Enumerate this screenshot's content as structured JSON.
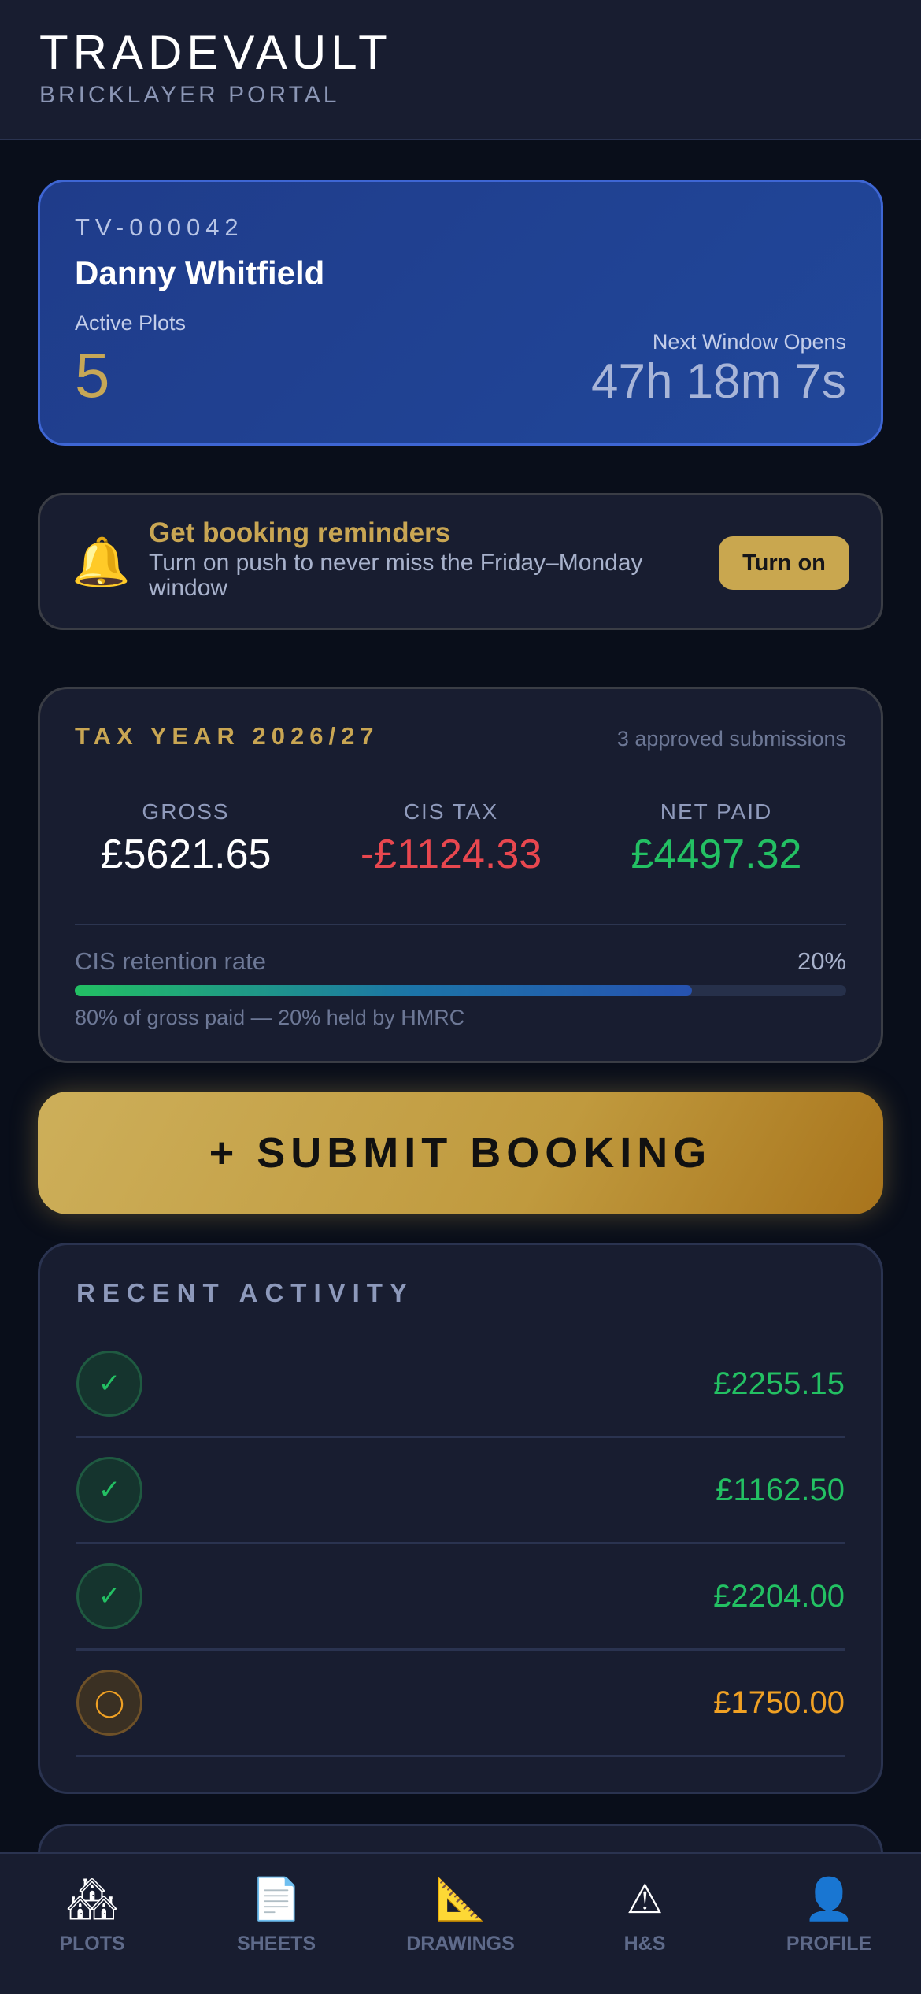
{
  "header": {
    "brand": "TRADEVAULT",
    "subtitle": "BRICKLAYER PORTAL"
  },
  "profile": {
    "member_id": "TV-000042",
    "name": "Danny Whitfield",
    "active_plots_label": "Active Plots",
    "active_plots_value": "5",
    "window_label": "Next Window Opens",
    "window_countdown": "47h 18m 7s"
  },
  "reminder": {
    "icon": "bell-icon",
    "title": "Get booking reminders",
    "description": "Turn on push to never miss the Friday–Monday window",
    "button_label": "Turn on"
  },
  "tax": {
    "title": "TAX YEAR 2026/27",
    "approved": "3 approved submissions",
    "gross_label": "GROSS",
    "gross_value": "£5621.65",
    "cis_label": "CIS TAX",
    "cis_value": "-£1124.33",
    "net_label": "NET PAID",
    "net_value": "£4497.32",
    "retention_label": "CIS retention rate",
    "retention_value": "20%",
    "retention_bar_fraction": 0.8,
    "retention_note": "80% of gross paid — 20% held by HMRC"
  },
  "submit": {
    "label": "+ SUBMIT BOOKING"
  },
  "activity": {
    "title": "RECENT ACTIVITY",
    "items": [
      {
        "status": "approved",
        "icon_glyph": "✓",
        "amount": "£2255.15"
      },
      {
        "status": "approved",
        "icon_glyph": "✓",
        "amount": "£1162.50"
      },
      {
        "status": "approved",
        "icon_glyph": "✓",
        "amount": "£2204.00"
      },
      {
        "status": "pending",
        "icon_glyph": "◯",
        "amount": "£1750.00"
      }
    ]
  },
  "nav": {
    "plots": {
      "icon": "🏘",
      "label": "PLOTS"
    },
    "sheets": {
      "icon": "📄",
      "label": "SHEETS"
    },
    "drawings": {
      "icon": "📐",
      "label": "DRAWINGS"
    },
    "hs": {
      "icon": "⚠",
      "label": "H&S"
    },
    "profile": {
      "icon": "👤",
      "label": "PROFILE"
    }
  },
  "colors": {
    "gold": "#c9a653",
    "green": "#23c063",
    "red": "#e8474f",
    "orange": "#f0a124",
    "card_blue": "#21479a",
    "background": "#090e1a"
  }
}
